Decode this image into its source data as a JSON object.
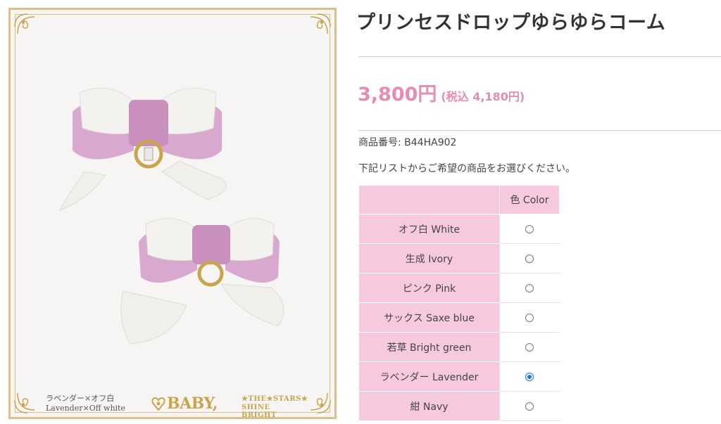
{
  "image": {
    "caption_ja": "ラベンダー×オフ白",
    "caption_en": "Lavender×Off white",
    "brand_main": "BABY,",
    "brand_line1": "★THE★STARS★",
    "brand_line2": "SHINE BRIGHT",
    "frame_color": "#d9c08a",
    "bow_color": "#d7a6cd",
    "lace_color": "#f4f2ee"
  },
  "product": {
    "title": "プリンセスドロップゆらゆらコーム",
    "price": "3,800円",
    "tax_price": "(税込  4,180円)",
    "sku": "商品番号: B44HA902",
    "instructions": "下記リストからご希望の商品をお選びください。",
    "accent_color": "#e58cb5"
  },
  "options": {
    "column_header": "色 Color",
    "header_color": "#f7c9de",
    "rows": [
      {
        "label": "オフ白 White",
        "selected": false
      },
      {
        "label": "生成 Ivory",
        "selected": false
      },
      {
        "label": "ピンク Pink",
        "selected": false
      },
      {
        "label": "サックス Saxe blue",
        "selected": false
      },
      {
        "label": "若草 Bright green",
        "selected": false
      },
      {
        "label": "ラベンダー Lavender",
        "selected": true
      },
      {
        "label": "紺 Navy",
        "selected": false
      }
    ]
  }
}
